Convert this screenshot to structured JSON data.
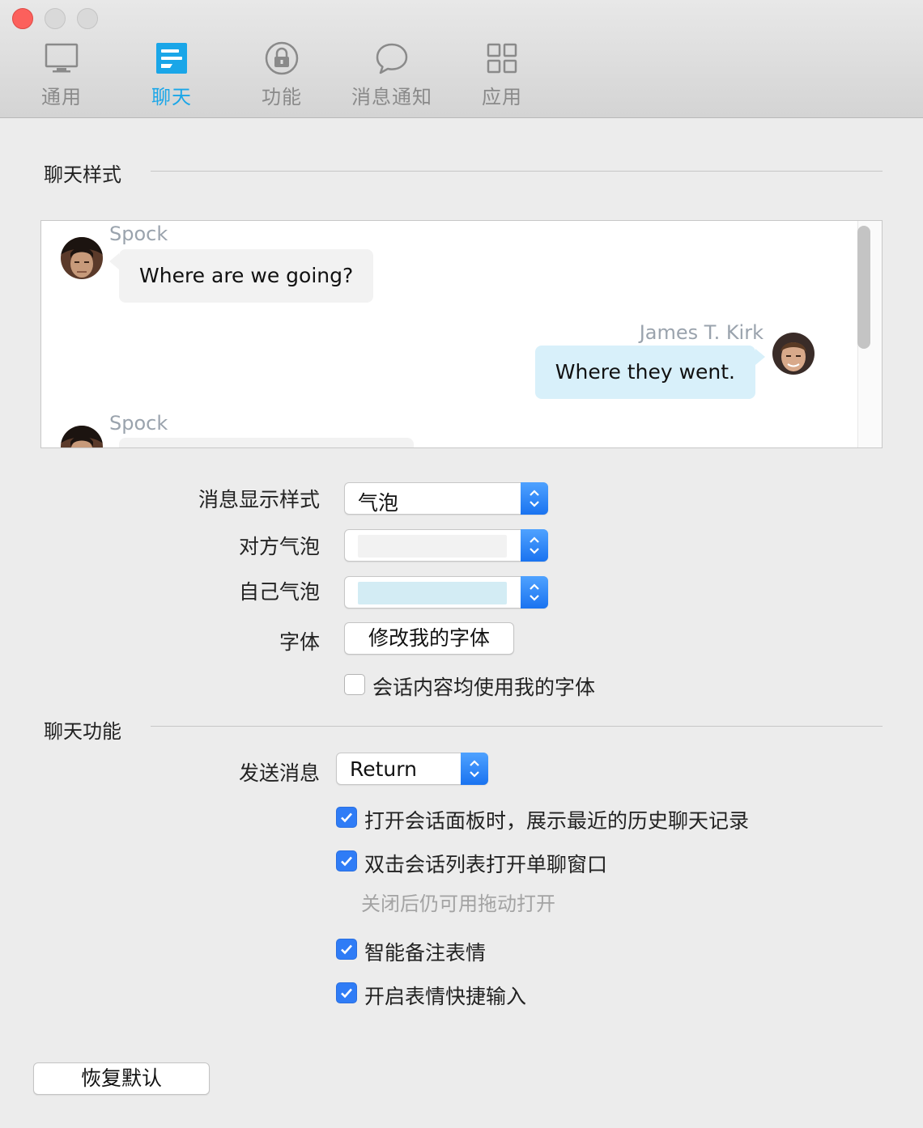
{
  "toolbar": {
    "tabs": [
      {
        "label": "通用",
        "icon": "monitor-icon"
      },
      {
        "label": "聊天",
        "icon": "chat-style-icon"
      },
      {
        "label": "功能",
        "icon": "lock-icon"
      },
      {
        "label": "消息通知",
        "icon": "speech-bubble-icon"
      },
      {
        "label": "应用",
        "icon": "grid-icon"
      }
    ],
    "active_tab": "聊天",
    "active_color": "#1aa6e8"
  },
  "chat_style": {
    "title": "聊天样式",
    "preview": {
      "messages": [
        {
          "sender": "Spock",
          "text": "Where are we going?",
          "side": "left"
        },
        {
          "sender": "James T. Kirk",
          "text": "Where they went.",
          "side": "right"
        },
        {
          "sender": "Spock",
          "text": "",
          "side": "left"
        }
      ]
    },
    "display_style": {
      "label": "消息显示样式",
      "value": "气泡"
    },
    "other_bubble": {
      "label": "对方气泡",
      "color": "#f2f2f2"
    },
    "own_bubble": {
      "label": "自己气泡",
      "color": "#d3ecf4"
    },
    "font": {
      "label": "字体",
      "button": "修改我的字体"
    },
    "use_my_font": {
      "label": "会话内容均使用我的字体",
      "checked": false
    }
  },
  "chat_features": {
    "title": "聊天功能",
    "send_message": {
      "label": "发送消息",
      "value": "Return"
    },
    "options": [
      {
        "label": "打开会话面板时，展示最近的历史聊天记录",
        "checked": true
      },
      {
        "label": "双击会话列表打开单聊窗口",
        "checked": true,
        "hint": "关闭后仍可用拖动打开"
      },
      {
        "label": "智能备注表情",
        "checked": true
      },
      {
        "label": "开启表情快捷输入",
        "checked": true
      }
    ]
  },
  "restore_button": "恢复默认"
}
